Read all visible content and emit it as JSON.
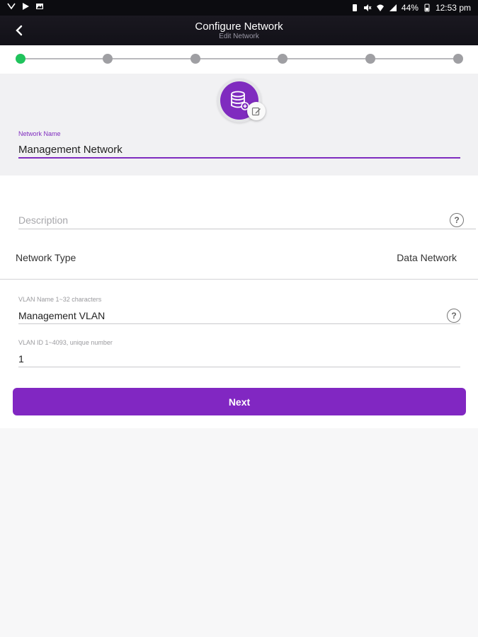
{
  "status_bar": {
    "battery": "44%",
    "time": "12:53 pm"
  },
  "header": {
    "title": "Configure Network",
    "subtitle": "Edit Network"
  },
  "stepper": {
    "total_steps": 6,
    "current_step": 1,
    "active_color": "#20c35c",
    "inactive_color": "#9f9fa3"
  },
  "network_name": {
    "label": "Network Name",
    "value": "Management Network"
  },
  "description": {
    "placeholder": "Description",
    "value": ""
  },
  "network_type": {
    "label": "Network Type",
    "value": "Data Network"
  },
  "vlan_name": {
    "label": "VLAN Name   1~32 characters",
    "value": "Management VLAN"
  },
  "vlan_id": {
    "label": "VLAN ID   1~4093, unique number",
    "value": "1"
  },
  "actions": {
    "next_label": "Next"
  },
  "colors": {
    "accent": "#8127c2",
    "header_bg": "#121118"
  },
  "icons": {
    "avatar": "database-add-icon",
    "edit": "edit-icon",
    "back": "back-chevron-icon",
    "help": "help-circle-icon"
  }
}
